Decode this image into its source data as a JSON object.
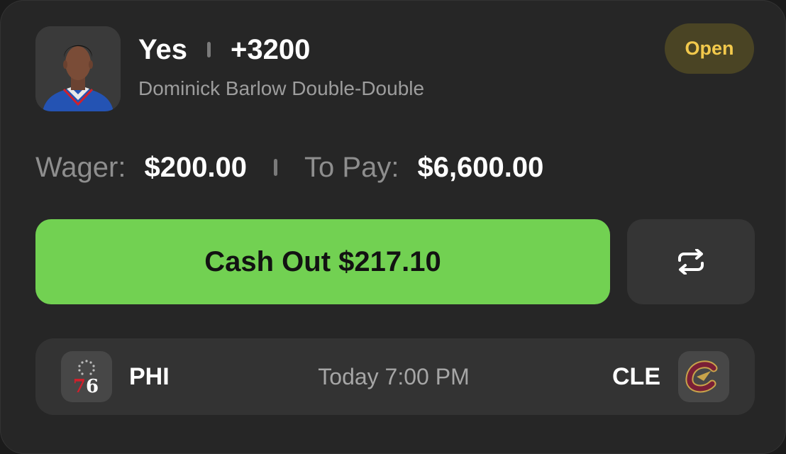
{
  "bet": {
    "selection": "Yes",
    "odds": "+3200",
    "market": "Dominick Barlow Double-Double",
    "status": "Open"
  },
  "amounts": {
    "wager_label": "Wager:",
    "wager_value": "$200.00",
    "to_pay_label": "To Pay:",
    "to_pay_value": "$6,600.00"
  },
  "actions": {
    "cashout_label": "Cash Out $217.10",
    "swap_icon": "swap-arrows-icon"
  },
  "game": {
    "home_abbr": "PHI",
    "away_abbr": "CLE",
    "time": "Today 7:00 PM",
    "home_logo_text": "76",
    "home_logo_icon": "76ers-logo-icon",
    "away_logo_icon": "cavaliers-logo-icon"
  },
  "colors": {
    "card_bg": "#262626",
    "accent_green": "#72d152",
    "status_yellow": "#f2c94c",
    "status_bg": "#4a4424",
    "sixers_red": "#d0202c",
    "cavs_wine": "#7a1f36",
    "cavs_gold": "#c8a34a"
  }
}
